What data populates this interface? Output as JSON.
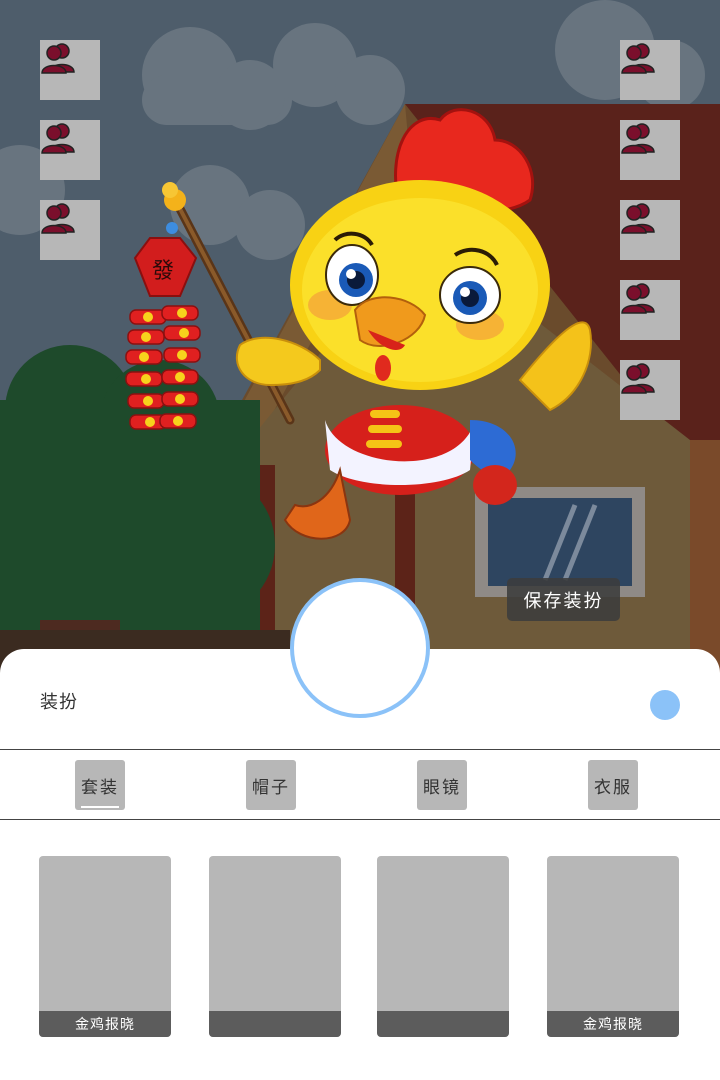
{
  "scene": {
    "left_buttons": [
      {
        "icon": "users-icon"
      },
      {
        "icon": "users-icon"
      },
      {
        "icon": "users-icon"
      }
    ],
    "right_buttons": [
      {
        "icon": "users-icon"
      },
      {
        "icon": "users-icon"
      },
      {
        "icon": "users-icon"
      },
      {
        "icon": "users-icon"
      },
      {
        "icon": "users-icon"
      }
    ],
    "lantern_char": "發",
    "save_label": "保存装扮"
  },
  "panel": {
    "title": "装扮",
    "tabs": [
      {
        "label": "套装",
        "selected": true
      },
      {
        "label": "帽子",
        "selected": false
      },
      {
        "label": "眼镜",
        "selected": false
      },
      {
        "label": "衣服",
        "selected": false
      }
    ],
    "items": [
      {
        "caption": "金鸡报晓"
      },
      {
        "caption": ""
      },
      {
        "caption": ""
      },
      {
        "caption": "金鸡报晓"
      }
    ]
  },
  "colors": {
    "accent": "#8bc2f8",
    "button_gray": "#b7b7b7",
    "caption_bar": "#5c5c5c",
    "icon_fill": "#7b0f2c"
  }
}
